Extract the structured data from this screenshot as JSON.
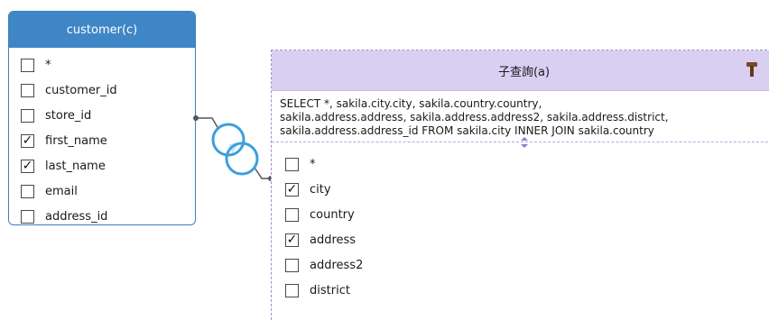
{
  "customer_table": {
    "title": "customer(c)",
    "fields": [
      {
        "label": "*",
        "checked": false
      },
      {
        "label": "customer_id",
        "checked": false
      },
      {
        "label": "store_id",
        "checked": false
      },
      {
        "label": "first_name",
        "checked": true
      },
      {
        "label": "last_name",
        "checked": true
      },
      {
        "label": "email",
        "checked": false
      },
      {
        "label": "address_id",
        "checked": false
      }
    ]
  },
  "subquery": {
    "title": "子查詢(a)",
    "sql_lines": [
      "SELECT  *,   sakila.city.city,   sakila.country.country,",
      "sakila.address.address,   sakila.address.address2,   sakila.address.district,",
      "sakila.address.address_id FROM  sakila.city  INNER JOIN  sakila.country"
    ],
    "fields": [
      {
        "label": "*",
        "checked": false
      },
      {
        "label": "city",
        "checked": true
      },
      {
        "label": "country",
        "checked": false
      },
      {
        "label": "address",
        "checked": true
      },
      {
        "label": "address2",
        "checked": false
      },
      {
        "label": "district",
        "checked": false
      }
    ]
  },
  "colors": {
    "customer_header": "#3f86c6",
    "subquery_header": "#d8cff2",
    "join_link": "#3d9fdc"
  },
  "icons": {
    "join": "inner-join-circles-icon",
    "build": "hammer-icon"
  }
}
